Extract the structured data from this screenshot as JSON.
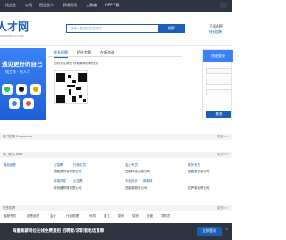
{
  "topnav": {
    "items": [
      "找企业",
      "公司",
      "招企业人",
      "职场资讯",
      "工具箱",
      "APP下载"
    ]
  },
  "header": {
    "logo": "人才网",
    "logo_sub": "JOBSRENCAI.COM",
    "search_placeholder": "请输入要搜索的关键字",
    "search_button": "搜索",
    "app_title": "下载APP",
    "app_sub": "快速招聘"
  },
  "banner": {
    "title": "遇见更好的自己",
    "subtitle": "找工作 · 招人才"
  },
  "tabs": [
    "联系招聘",
    "招社专题",
    "在线咨询"
  ],
  "contact_text": "扫码关注微信   获取最新招聘信息",
  "login": {
    "title": "快速登录",
    "button": "登录"
  },
  "sections": [
    {
      "title": "热门招聘 Enterprise",
      "more": "更多>>"
    },
    {
      "title": "热门职位 Jobs",
      "more": "更多>>"
    },
    {
      "title": "更多招聘",
      "more": "更多>>"
    }
  ],
  "jobs_row1": [
    "食品销售",
    "云招聘",
    "行政文员",
    "会计专员",
    "财务专员"
  ],
  "jobs_row2": [
    "前端开发",
    "云招聘",
    "平面设计",
    "新媒体"
  ],
  "jobs_companies": [
    "西藏某贸易有限公司",
    "西藏科技发展公司",
    "西藏某信息公司"
  ],
  "jobs_companies2": [
    "新西藏贸易有限公司",
    "西藏某服务公司",
    "拉萨某商贸公司"
  ],
  "more_links": [
    "客服专员",
    "销售经理",
    "会计",
    "行政助理",
    "司机",
    "普工",
    "厨师",
    "保安",
    "仓管",
    "导购员"
  ],
  "bottom": {
    "text": "海量高薪岗位在线免费直招 招聘者/求职者电话直聊",
    "button": "立即登录",
    "close": "×"
  }
}
